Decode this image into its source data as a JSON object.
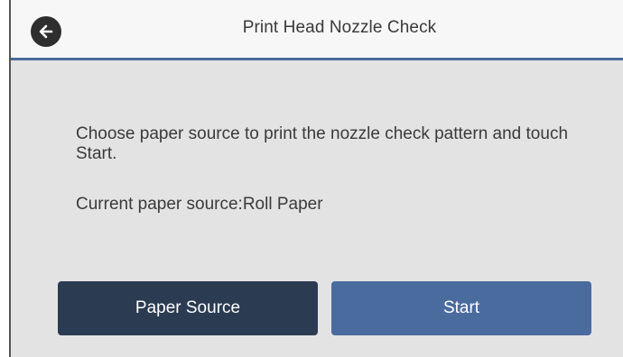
{
  "header": {
    "title": "Print Head Nozzle Check",
    "back_icon": "back-arrow-icon"
  },
  "body": {
    "message": "Choose paper source to print the nozzle check pattern and touch Start.",
    "current_source": "Current paper source:Roll Paper"
  },
  "buttons": {
    "paper_source_label": "Paper Source",
    "start_label": "Start"
  },
  "colors": {
    "accent": "#4a6b9a",
    "dark_button": "#2b3b52",
    "primary_button": "#4a6b9e",
    "background": "#e3e3e3"
  }
}
